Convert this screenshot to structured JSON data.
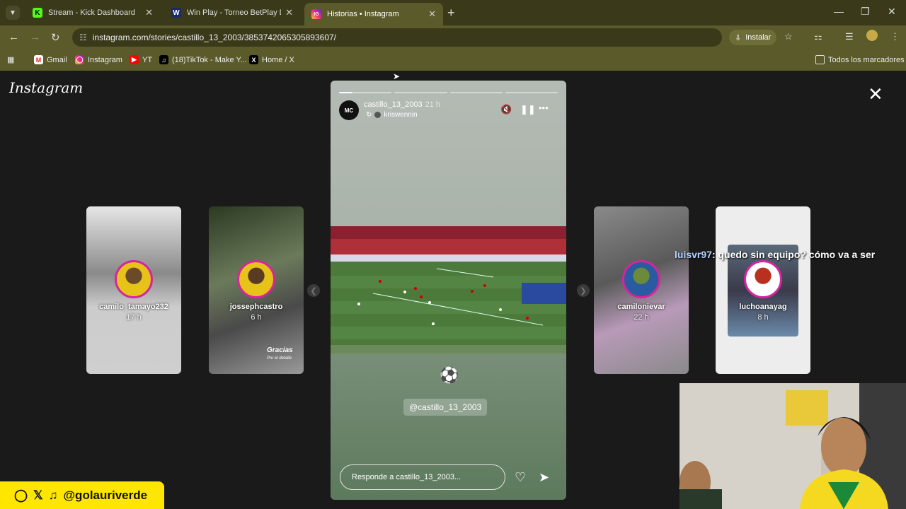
{
  "tabs": [
    {
      "title": "Stream - Kick Dashboard",
      "favicon": "K"
    },
    {
      "title": "Win Play - Torneo BetPlay Dima",
      "favicon": "W"
    },
    {
      "title": "Historias • Instagram",
      "favicon": "IG"
    }
  ],
  "address": {
    "url": "instagram.com/stories/castillo_13_2003/3853742065305893607/"
  },
  "install_label": "Instalar",
  "bookmarks": {
    "items": [
      {
        "label": "Gmail"
      },
      {
        "label": "Instagram"
      },
      {
        "label": "YT"
      },
      {
        "label": "(18)TikTok - Make Y..."
      },
      {
        "label": "Home / X"
      }
    ],
    "all_label": "Todos los marcadores"
  },
  "page": {
    "logo_text": "Instagram"
  },
  "side_stories": [
    {
      "username": "camilo_tamayo232",
      "time": "17 h"
    },
    {
      "username": "jossephcastro",
      "time": "6 h"
    },
    {
      "username": "camilonievar",
      "time": "22 h"
    },
    {
      "username": "luchoanayag",
      "time": "8 h"
    }
  ],
  "story": {
    "username": "castillo_13_2003",
    "time": "21 h",
    "audio": "kriswennin",
    "avatar_text": "MC",
    "mention": "@castillo_13_2003",
    "reply_placeholder": "Responde a castillo_13_2003...",
    "sticker_text": "Gracias",
    "sticker_sub": "Por el detalle"
  },
  "chat": {
    "user": "luisvr97",
    "message": ": quedo sin equipo? cómo va a ser"
  },
  "social": {
    "handle": "@golauriverde"
  }
}
